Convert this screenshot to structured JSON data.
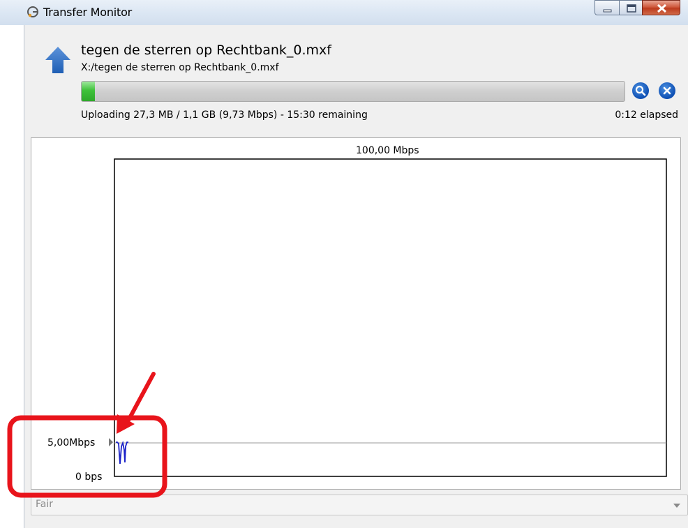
{
  "window": {
    "title": "Transfer Monitor"
  },
  "transfer": {
    "direction_icon": "upload-arrow-icon",
    "file_name": "tegen de sterren op Rechtbank_0.mxf",
    "file_path": "X:/tegen de sterren op Rechtbank_0.mxf",
    "progress_fraction": 0.025,
    "status": "Uploading 27,3 MB / 1,1 GB (9,73 Mbps) - 15:30 remaining",
    "elapsed": "0:12 elapsed"
  },
  "actions": {
    "search_icon": "magnifier-icon",
    "cancel_icon": "close-circle-icon"
  },
  "graph": {
    "max_label": "100,00 Mbps",
    "current_label": "5,00Mbps",
    "zero_label": "0 bps"
  },
  "quality": {
    "selected": "Fair"
  },
  "colors": {
    "progress_fill": "#3fc13a",
    "accent_blue": "#1553b8",
    "annotation_red": "#e8141b",
    "graph_line": "#1b22c8"
  }
}
